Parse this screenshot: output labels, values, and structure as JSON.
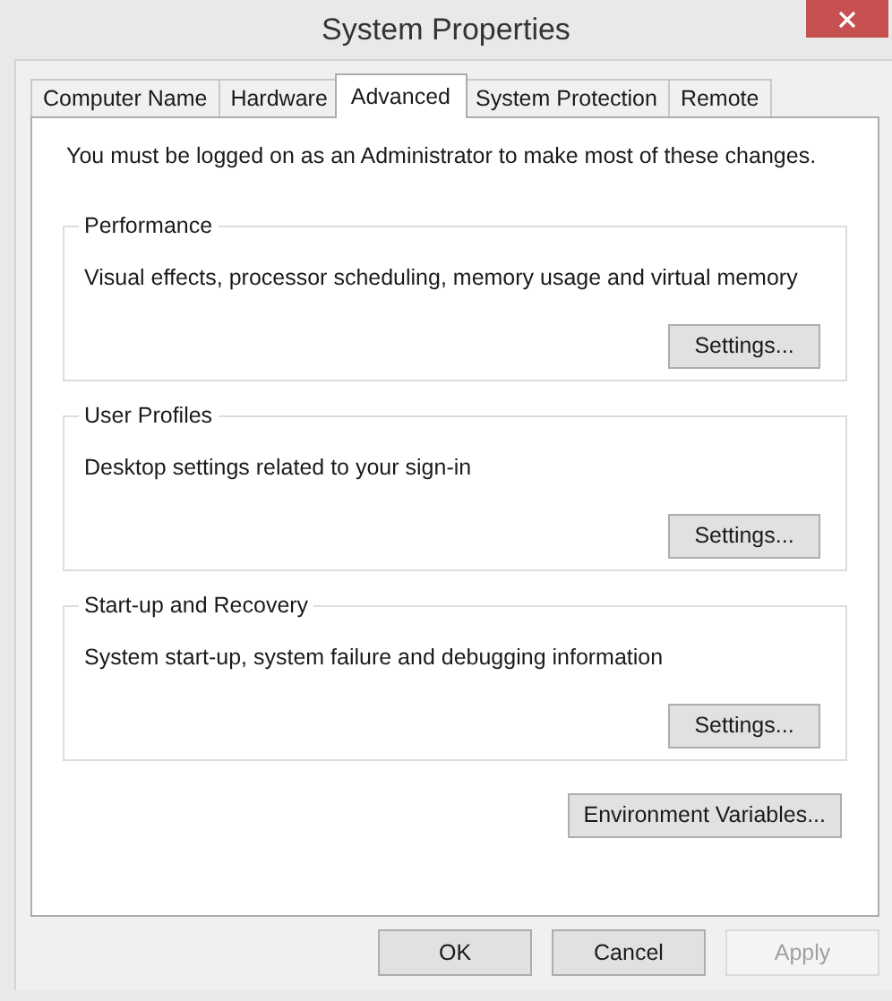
{
  "window": {
    "title": "System Properties"
  },
  "tabs": [
    {
      "label": "Computer Name",
      "selected": false
    },
    {
      "label": "Hardware",
      "selected": false
    },
    {
      "label": "Advanced",
      "selected": true
    },
    {
      "label": "System Protection",
      "selected": false
    },
    {
      "label": "Remote",
      "selected": false
    }
  ],
  "notice": "You must be logged on as an Administrator to make most of these changes.",
  "groups": [
    {
      "title": "Performance",
      "description": "Visual effects, processor scheduling, memory usage and virtual memory",
      "button": "Settings..."
    },
    {
      "title": "User Profiles",
      "description": "Desktop settings related to your sign-in",
      "button": "Settings..."
    },
    {
      "title": "Start-up and Recovery",
      "description": "System start-up, system failure and debugging information",
      "button": "Settings..."
    }
  ],
  "environment_button": "Environment Variables...",
  "buttons": [
    {
      "label": "OK",
      "disabled": false
    },
    {
      "label": "Cancel",
      "disabled": false
    },
    {
      "label": "Apply",
      "disabled": true
    }
  ]
}
